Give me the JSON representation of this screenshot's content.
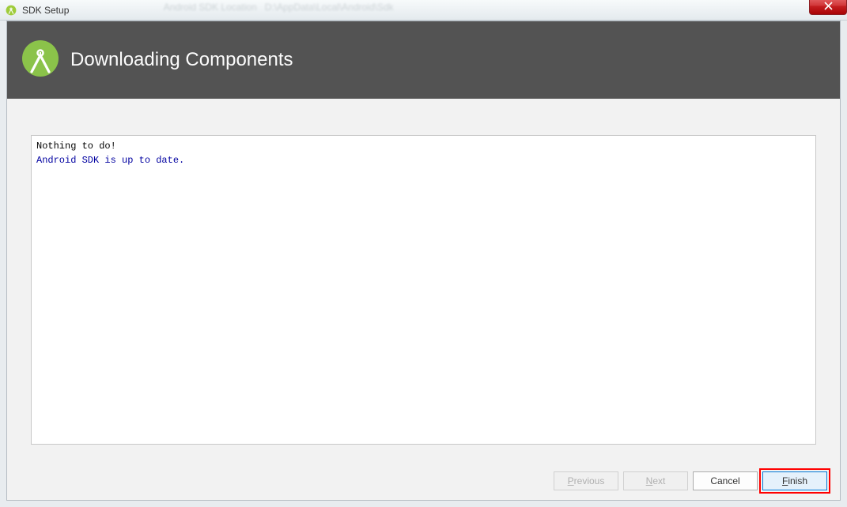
{
  "titlebar": {
    "text": "SDK Setup"
  },
  "header": {
    "title": "Downloading Components"
  },
  "console": {
    "line1": "Nothing to do!",
    "line2": "Android SDK is up to date."
  },
  "buttons": {
    "previous": "Previous",
    "next": "Next",
    "cancel": "Cancel",
    "finish": "Finish"
  }
}
